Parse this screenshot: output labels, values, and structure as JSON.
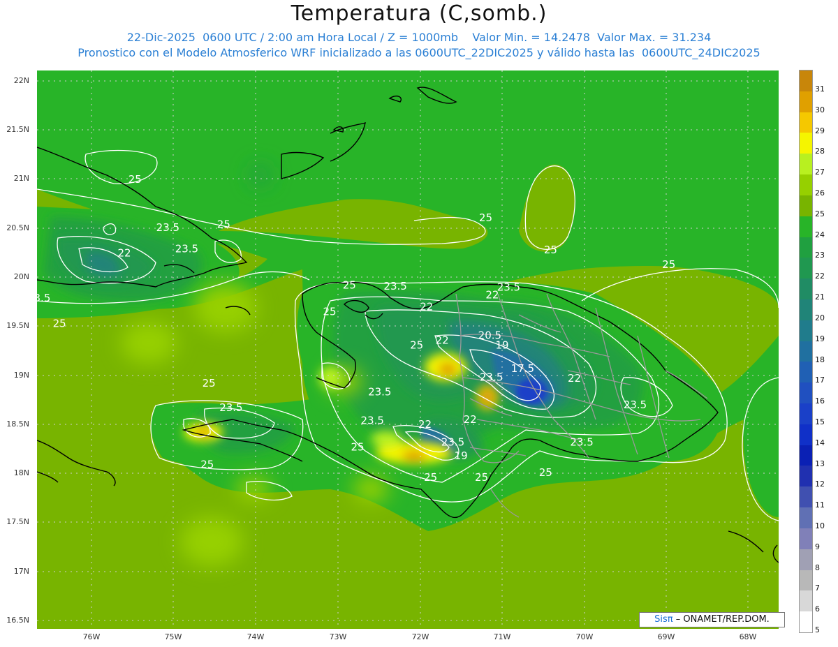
{
  "header": {
    "title": "Temperatura (C,somb.)",
    "line1": "22-Dic-2025  0600 UTC / 2:00 am Hora Local / Z = 1000mb    Valor Min. = 14.2478  Valor Max. = 31.234",
    "line2": "Pronostico con el Modelo Atmosferico WRF inicializado a las 0600UTC_22DIC2025 y válido hasta las  0600UTC_24DIC2025"
  },
  "axes": {
    "lat_labels": [
      "22N",
      "21.5N",
      "21N",
      "20.5N",
      "20N",
      "19.5N",
      "19N",
      "18.5N",
      "18N",
      "17.5N",
      "17N",
      "16.5N"
    ],
    "lon_labels": [
      "76W",
      "75W",
      "74W",
      "73W",
      "72W",
      "71W",
      "70W",
      "69W",
      "68W"
    ]
  },
  "colorbar": {
    "labels": [
      "31",
      "30",
      "29",
      "28",
      "27",
      "26",
      "25",
      "24",
      "23",
      "22",
      "21",
      "20",
      "19",
      "18",
      "17",
      "16",
      "15",
      "14",
      "13",
      "12",
      "11",
      "10",
      "9",
      "8",
      "7",
      "6",
      "5"
    ],
    "colors": [
      "#c8860a",
      "#e0a000",
      "#f5c800",
      "#f5f500",
      "#b8f020",
      "#96d000",
      "#78b400",
      "#28b428",
      "#20a040",
      "#209850",
      "#208c64",
      "#208478",
      "#207c8c",
      "#2070a0",
      "#2060b4",
      "#2050c0",
      "#1a40c8",
      "#1030c8",
      "#0a20b4",
      "#2030b0",
      "#4050b0",
      "#6070b4",
      "#8080b8",
      "#a0a0b4",
      "#b8b8b8",
      "#d8d8d8",
      "#ffffff"
    ]
  },
  "contour_labels": [
    {
      "text": "25",
      "lon": -75.47,
      "lat": 20.96
    },
    {
      "text": "25",
      "lon": -74.39,
      "lat": 20.5
    },
    {
      "text": "23.5",
      "lon": -75.07,
      "lat": 20.47
    },
    {
      "text": "22",
      "lon": -75.6,
      "lat": 20.21
    },
    {
      "text": "23.5",
      "lon": -74.84,
      "lat": 20.25
    },
    {
      "text": "3.5",
      "lon": -76.6,
      "lat": 19.75
    },
    {
      "text": "25",
      "lon": -76.39,
      "lat": 19.49
    },
    {
      "text": "25",
      "lon": -72.86,
      "lat": 19.88
    },
    {
      "text": "23.5",
      "lon": -72.3,
      "lat": 19.87
    },
    {
      "text": "25",
      "lon": -73.1,
      "lat": 19.61
    },
    {
      "text": "22",
      "lon": -71.92,
      "lat": 19.66
    },
    {
      "text": "22",
      "lon": -71.12,
      "lat": 19.78
    },
    {
      "text": "23.5",
      "lon": -70.92,
      "lat": 19.86
    },
    {
      "text": "25",
      "lon": -71.2,
      "lat": 20.57
    },
    {
      "text": "25",
      "lon": -70.41,
      "lat": 20.24
    },
    {
      "text": "25",
      "lon": -68.97,
      "lat": 20.09
    },
    {
      "text": "20.5",
      "lon": -71.15,
      "lat": 19.37
    },
    {
      "text": "19",
      "lon": -71.0,
      "lat": 19.27
    },
    {
      "text": "22",
      "lon": -71.73,
      "lat": 19.32
    },
    {
      "text": "25",
      "lon": -72.04,
      "lat": 19.27
    },
    {
      "text": "17.5",
      "lon": -70.75,
      "lat": 19.03
    },
    {
      "text": "23.5",
      "lon": -71.13,
      "lat": 18.94
    },
    {
      "text": "22",
      "lon": -70.12,
      "lat": 18.93
    },
    {
      "text": "25",
      "lon": -74.57,
      "lat": 18.88
    },
    {
      "text": "23.5",
      "lon": -72.49,
      "lat": 18.79
    },
    {
      "text": "23.5",
      "lon": -74.3,
      "lat": 18.63
    },
    {
      "text": "23.5",
      "lon": -72.58,
      "lat": 18.5
    },
    {
      "text": "22",
      "lon": -71.94,
      "lat": 18.46
    },
    {
      "text": "22",
      "lon": -71.39,
      "lat": 18.51
    },
    {
      "text": "23.5",
      "lon": -69.38,
      "lat": 18.66
    },
    {
      "text": "23.5",
      "lon": -71.6,
      "lat": 18.28
    },
    {
      "text": "23.5",
      "lon": -70.03,
      "lat": 18.28
    },
    {
      "text": "25",
      "lon": -72.76,
      "lat": 18.23
    },
    {
      "text": "19",
      "lon": -71.5,
      "lat": 18.14
    },
    {
      "text": "25",
      "lon": -74.59,
      "lat": 18.05
    },
    {
      "text": "25",
      "lon": -71.87,
      "lat": 17.92
    },
    {
      "text": "25",
      "lon": -71.25,
      "lat": 17.92
    },
    {
      "text": "25",
      "lon": -70.47,
      "lat": 17.97
    }
  ],
  "credit": {
    "sis": "Sisπ",
    "rest": "– ONAMET/REP.DOM."
  }
}
